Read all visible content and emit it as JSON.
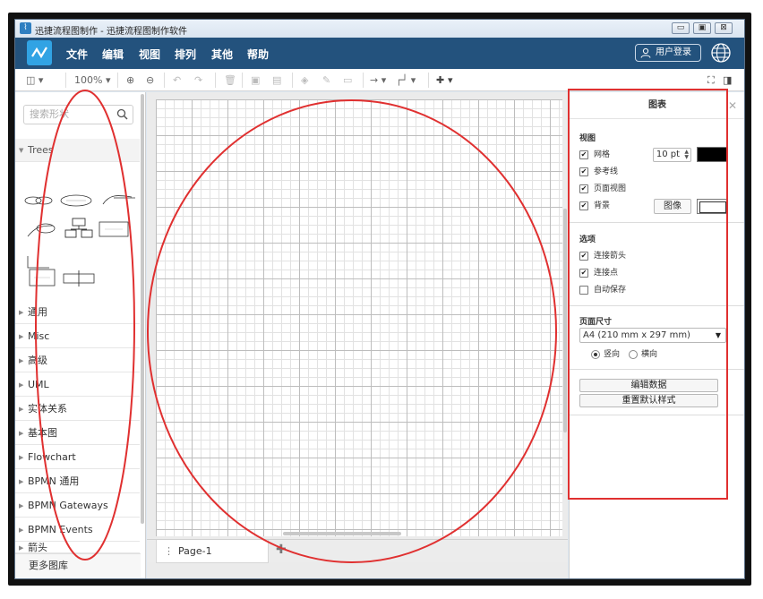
{
  "window": {
    "title": "迅捷流程图制作 - 迅捷流程图制作软件",
    "controls": [
      "minimize",
      "maximize",
      "close"
    ]
  },
  "menubar": {
    "items": [
      "文件",
      "编辑",
      "视图",
      "排列",
      "其他",
      "帮助"
    ],
    "login_label": "用户登录",
    "accent": "#23527d"
  },
  "toolbar": {
    "zoom": "100%",
    "icons": [
      "page-view-icon",
      "zoom-in-icon",
      "zoom-out-icon",
      "undo-icon",
      "redo-icon",
      "delete-icon",
      "to-front-icon",
      "to-back-icon",
      "fill-color-icon",
      "line-color-icon",
      "shadow-icon",
      "connection-icon",
      "waypoints-icon",
      "insert-icon",
      "fit-icon",
      "fullscreen-icon"
    ]
  },
  "sidebar": {
    "search_placeholder": "搜索形状",
    "open_section": "Trees",
    "sections": [
      "通用",
      "Misc",
      "高级",
      "UML",
      "实体关系",
      "基本图",
      "Flowchart",
      "BPMN 通用",
      "BPMN Gateways",
      "BPMN Events",
      "箭头"
    ],
    "more_shapes": "更多图库"
  },
  "canvas": {
    "page_tab": "Page-1"
  },
  "format_panel": {
    "title": "图表",
    "view_header": "视图",
    "grid_label": "网格",
    "grid_size": "10 pt",
    "guides_label": "参考线",
    "page_view_label": "页面视图",
    "background_label": "背景",
    "image_button": "图像",
    "options_header": "选项",
    "connection_arrows_label": "连接箭头",
    "connection_points_label": "连接点",
    "autosave_label": "自动保存",
    "page_size_header": "页面尺寸",
    "page_size_value": "A4 (210 mm x 297 mm)",
    "portrait_label": "竖向",
    "landscape_label": "横向",
    "edit_data_button": "编辑数据",
    "reset_style_button": "重置默认样式",
    "grid_checked": true,
    "guides_checked": true,
    "page_view_checked": true,
    "background_checked": true,
    "connection_arrows_checked": true,
    "connection_points_checked": true,
    "autosave_checked": false,
    "orientation": "竖向"
  },
  "annotation_color": "#e03030"
}
